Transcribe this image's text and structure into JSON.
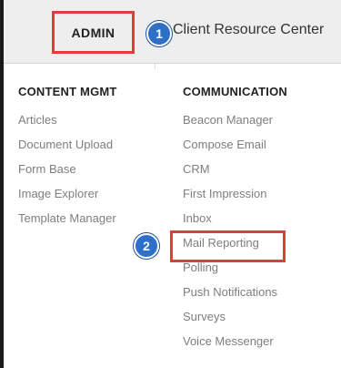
{
  "nav": {
    "admin_label": "ADMIN",
    "client_resource_label": "Client Resource Center"
  },
  "callouts": {
    "step1": "1",
    "step2": "2"
  },
  "menu": {
    "content": {
      "heading": "CONTENT MGMT",
      "items": [
        "Articles",
        "Document Upload",
        "Form Base",
        "Image Explorer",
        "Template Manager"
      ]
    },
    "communication": {
      "heading": "COMMUNICATION",
      "items": [
        "Beacon Manager",
        "Compose Email",
        "CRM",
        "First Impression",
        "Inbox",
        "Mail Reporting",
        "Polling",
        "Push Notifications",
        "Surveys",
        "Voice Messenger"
      ]
    }
  },
  "colors": {
    "highlight": "#e23b3b",
    "callout_badge": "#2e70c7"
  }
}
